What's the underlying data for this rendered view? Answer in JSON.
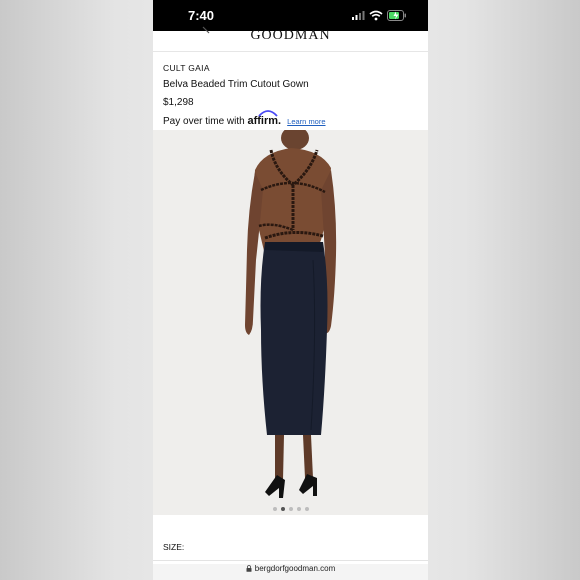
{
  "status_bar": {
    "time": "7:40"
  },
  "header": {
    "logo": "GOODMAN"
  },
  "product": {
    "brand": "CULT GAIA",
    "name": "Belva Beaded Trim Cutout Gown",
    "price": "$1,298"
  },
  "affirm": {
    "prefix": "Pay over time with",
    "logo_text": "affirm",
    "logo_dot": ".",
    "learn_more": "Learn more"
  },
  "gallery": {
    "image_count": 5,
    "active_index": 1
  },
  "size": {
    "label": "SIZE:"
  },
  "browser": {
    "url": "bergdorfgoodman.com"
  },
  "colors": {
    "accent_link": "#1f5fbf",
    "status_bg": "#000000",
    "gown": "#1c2233"
  }
}
